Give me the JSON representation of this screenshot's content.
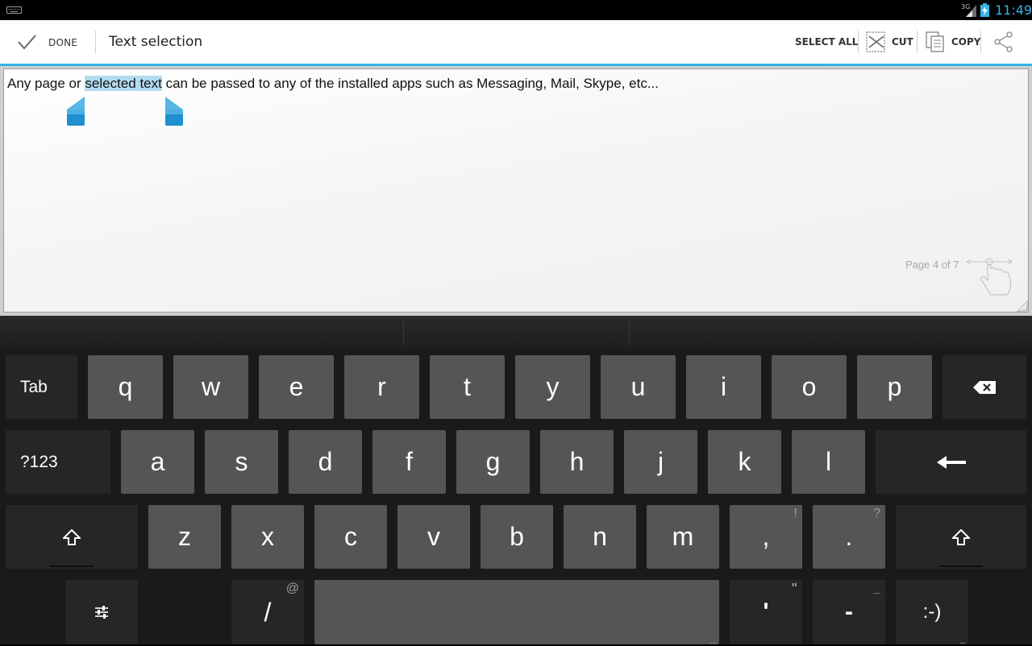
{
  "status_bar": {
    "time": "11:49",
    "network": "3G",
    "colors": {
      "clock": "#33b5e5"
    }
  },
  "action_bar": {
    "done_label": "DONE",
    "title": "Text selection",
    "select_all_label": "SELECT ALL",
    "cut_label": "CUT",
    "copy_label": "COPY",
    "icons": [
      "check-icon",
      "cut-icon",
      "copy-icon",
      "share-icon"
    ],
    "accent_color": "#33b5e5"
  },
  "document": {
    "text_before": "Any page or ",
    "text_selected": "selected text",
    "text_after": " can be passed to any of the installed apps such as Messaging, Mail, Skype, etc...",
    "page_indicator": "Page 4 of 7",
    "selection_color": "#b3dbef"
  },
  "keyboard": {
    "row1": {
      "tab": "Tab",
      "keys": [
        "q",
        "w",
        "e",
        "r",
        "t",
        "y",
        "u",
        "i",
        "o",
        "p"
      ]
    },
    "row2": {
      "symbols": "?123",
      "keys": [
        "a",
        "s",
        "d",
        "f",
        "g",
        "h",
        "j",
        "k",
        "l"
      ]
    },
    "row3": {
      "keys": [
        "z",
        "x",
        "c",
        "v",
        "b",
        "n",
        "m"
      ],
      "comma": ",",
      "comma_hint": "!",
      "period": ".",
      "period_hint": "?"
    },
    "row4": {
      "slash": "/",
      "slash_hint": "@",
      "apostrophe": "'",
      "apostrophe_hint": "\"",
      "dash": "-",
      "dash_hint": "_",
      "smiley": ":-)",
      "more_dots": "..."
    }
  }
}
